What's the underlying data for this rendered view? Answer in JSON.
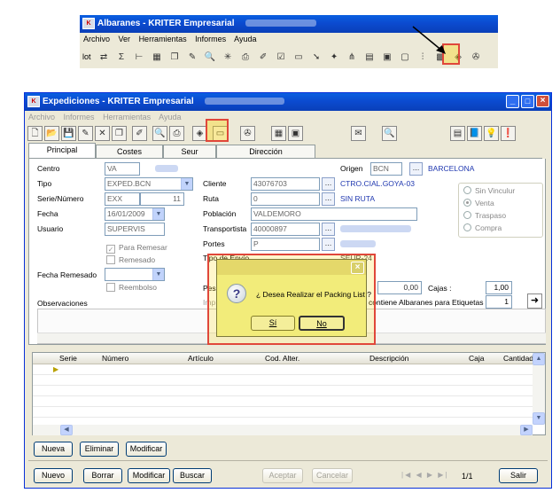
{
  "top_window": {
    "title": "Albaranes - KRITER Empresarial",
    "menu": [
      "Archivo",
      "Ver",
      "Herramientas",
      "Informes",
      "Ayuda"
    ],
    "toolbar_label": "lot"
  },
  "main_window": {
    "title": "Expediciones - KRITER Empresarial",
    "menu": [
      "Archivo",
      "Informes",
      "Herramientas",
      "Ayuda"
    ],
    "tabs": [
      "Principal",
      "Costes",
      "Seur",
      "Dirección"
    ],
    "form": {
      "centro_label": "Centro",
      "centro_value": "VA",
      "tipo_label": "Tipo",
      "tipo_value": "EXPED.BCN",
      "serie_label": "Serie/Número",
      "serie_value": "EXX",
      "numero_value": "11",
      "fecha_label": "Fecha",
      "fecha_value": "16/01/2009",
      "usuario_label": "Usuario",
      "usuario_value": "SUPERVIS",
      "para_remesar": "Para Remesar",
      "remesado": "Remesado",
      "fecha_remesado_label": "Fecha Remesado",
      "reembolso": "Reembolso",
      "observaciones_label": "Observaciones",
      "cliente_label": "Cliente",
      "cliente_value": "43076703",
      "cliente_name": "CTRO.CIAL.GOYA-03",
      "ruta_label": "Ruta",
      "ruta_value": "0",
      "ruta_name": "SIN RUTA",
      "poblacion_label": "Población",
      "poblacion_value": "VALDEMORO",
      "transportista_label": "Transportista",
      "transportista_value": "40000897",
      "portes_label": "Portes",
      "portes_value": "P",
      "tipo_envio_label": "Tipo de Envío",
      "tipo_envio_value": "SEUR-24",
      "peso_label": "Pes",
      "importe_label": "Imp",
      "origen_label": "Origen",
      "origen_value": "BCN",
      "origen_name": "BARCELONA",
      "radios": [
        "Sin Vinculur",
        "Venta",
        "Traspaso",
        "Compra"
      ],
      "cajas_amount": "0,00",
      "cajas_label": "Cajas :",
      "cajas_value": "1,00",
      "etiquetas_label": "contiene Albaranes para Etiquetas",
      "etiquetas_value": "1"
    },
    "grid": {
      "columns": [
        "Serie",
        "Número",
        "Artículo",
        "Cod. Alter.",
        "Descripción",
        "Caja",
        "Cantidad"
      ]
    },
    "grid_buttons": [
      "Nueva",
      "Eliminar",
      "Modificar"
    ],
    "bottom_buttons": [
      "Nuevo",
      "Borrar",
      "Modificar",
      "Buscar",
      "Aceptar",
      "Cancelar",
      "Salir"
    ],
    "record_counter": "1/1"
  },
  "dialog": {
    "message": "¿ Desea Realizar el Packing List ?",
    "yes": "Sí",
    "no": "No"
  }
}
